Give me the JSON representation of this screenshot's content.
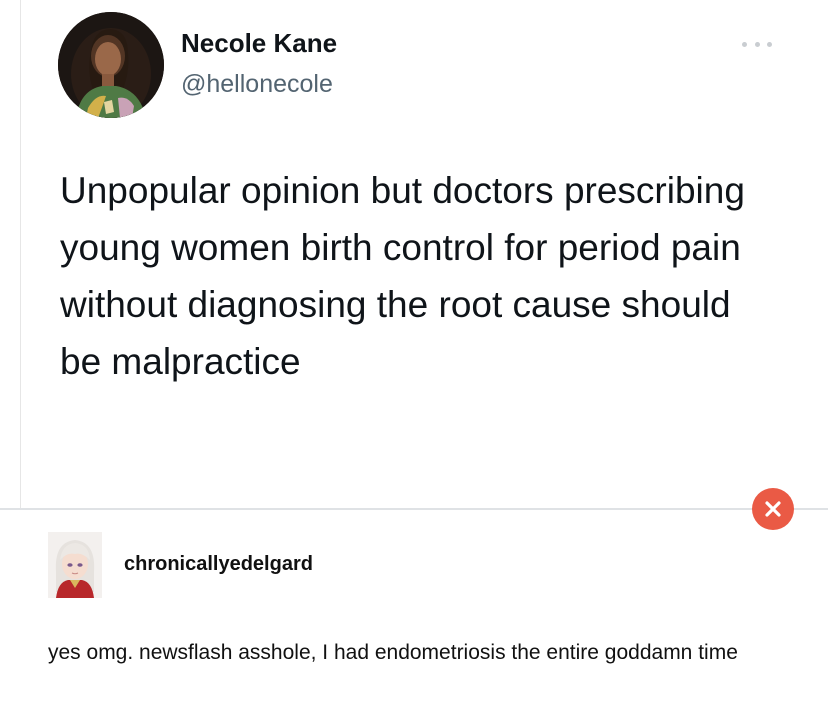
{
  "tweet": {
    "author_name": "Necole Kane",
    "handle": "@hellonecole",
    "text": "Unpopular opinion but doctors prescribing young women birth control for period pain without diagnosing the root cause should be malpractice",
    "more_icon": "more-horizontal-icon"
  },
  "close_icon": "close-icon",
  "reply": {
    "username": "chronicallyedelgard",
    "text": "yes omg. newsflash asshole, I had endometriosis the entire goddamn time"
  },
  "colors": {
    "close_button": "#ea5a45",
    "handle": "#536471",
    "text": "#0f1419"
  }
}
